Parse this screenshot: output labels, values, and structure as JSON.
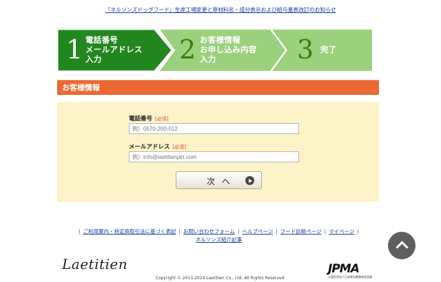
{
  "top_notice": "『ネルソンズドッグフード』生産工場変更と原材料名・成分表示および給与量表改訂のお知らせ",
  "steps": [
    {
      "number": "1",
      "label": "電話番号\nメールアドレス\n入力",
      "state": "active"
    },
    {
      "number": "2",
      "label": "お客様情報\nお申し込み内容\n入力",
      "state": "inactive"
    },
    {
      "number": "3",
      "label": "完了",
      "state": "inactive"
    }
  ],
  "section_title": "お客様情報",
  "form": {
    "phone_label": "電話番号",
    "phone_required": "[必須]",
    "phone_placeholder": "例）0570-200-012",
    "email_label": "メールアドレス",
    "email_required": "[必須]",
    "email_placeholder": "例）info@laetitienpet.com",
    "next_button": "次 へ"
  },
  "footer_links": [
    "ご利用案内・特定商取引法に基づく表記",
    "お問い合わせフォーム",
    "ヘルプページ",
    "フード診断ページ",
    "マイページ",
    "ネルソンズ紹介記事"
  ],
  "logo_text": "Laetitien",
  "copyright": "Copyright © 2013-2024 Laetitien Co., Ltd. All Rights Reserved.",
  "jpma_logo_text": "JPMA",
  "jpma_subtitle": "公益社団法人日本愛玩動物協会会員",
  "colors": {
    "step_active": "#22871e",
    "step_inactive": "#9bd17c",
    "section_header": "#ec6834",
    "form_bg": "#fcf3c8",
    "link": "#1a3d9c"
  },
  "icons": {
    "next_arrow": "play-circle-icon",
    "scroll_top": "chevron-up-icon"
  }
}
